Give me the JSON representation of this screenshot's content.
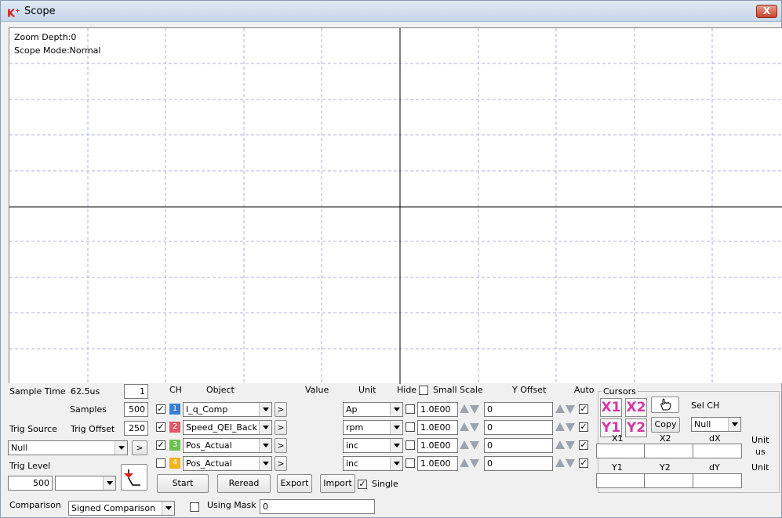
{
  "window": {
    "title": "Scope",
    "logo": "KS",
    "close": "X"
  },
  "scope": {
    "zoom_depth": "Zoom Depth:0",
    "mode": "Scope Mode:Normal",
    "grid_color": "#b0b0e0",
    "axis_color": "#000000"
  },
  "left_panel": {
    "sample_time_label": "Sample Time",
    "sample_time_value": "62.5us",
    "sample_time_mult": "1",
    "samples_label": "Samples",
    "samples_value": "500",
    "trig_source_label": "Trig Source",
    "trig_offset_label": "Trig Offset",
    "trig_offset_value": "250",
    "trig_source_value": "Null",
    "arrow_btn": ">",
    "trig_level_label": "Trig Level",
    "trig_level_value": "500",
    "trig_level_combo": "",
    "comparison_label": "Comparison",
    "comparison_value": "Signed Comparison",
    "using_mask_label": "Using Mask",
    "mask_value": "0"
  },
  "channels": {
    "headers": {
      "ch": "CH",
      "object": "Object",
      "value": "Value",
      "unit": "Unit",
      "hide": "Hide",
      "small_scale": "Small Scale",
      "y_offset": "Y Offset",
      "auto": "Auto"
    },
    "rows": [
      {
        "num": "1",
        "color": "#3a7fd0",
        "checked": "✓",
        "object": "I_q_Comp",
        "unit": "Ap",
        "scale": "1.0E00",
        "offset": "0",
        "auto": "✓"
      },
      {
        "num": "2",
        "color": "#e0566b",
        "checked": "✓",
        "object": "Speed_QEI_Back",
        "unit": "rpm",
        "scale": "1.0E00",
        "offset": "0",
        "auto": "✓"
      },
      {
        "num": "3",
        "color": "#6cc24a",
        "checked": "✓",
        "object": "Pos_Actual",
        "unit": "inc",
        "scale": "1.0E00",
        "offset": "0",
        "auto": "✓"
      },
      {
        "num": "4",
        "color": "#f2b21c",
        "checked": "",
        "object": "Pos_Actual",
        "unit": "inc",
        "scale": "1.0E00",
        "offset": "0",
        "auto": "✓"
      }
    ],
    "arrow_btn": ">"
  },
  "buttons": {
    "start": "Start",
    "reread": "Reread",
    "export": "Export",
    "import": "Import",
    "single": "Single",
    "single_checked": "✓"
  },
  "cursors": {
    "title": "Cursors",
    "x1": "X1",
    "x2": "X2",
    "y1": "Y1",
    "y2": "Y2",
    "copy": "Copy",
    "sel_ch_label": "Sel CH",
    "sel_ch_value": "Null",
    "cols_x": [
      "X1",
      "X2",
      "dX"
    ],
    "cols_y": [
      "Y1",
      "Y2",
      "dY"
    ],
    "unit_label": "Unit",
    "unit_x": "us",
    "unit_y": "Unit"
  }
}
